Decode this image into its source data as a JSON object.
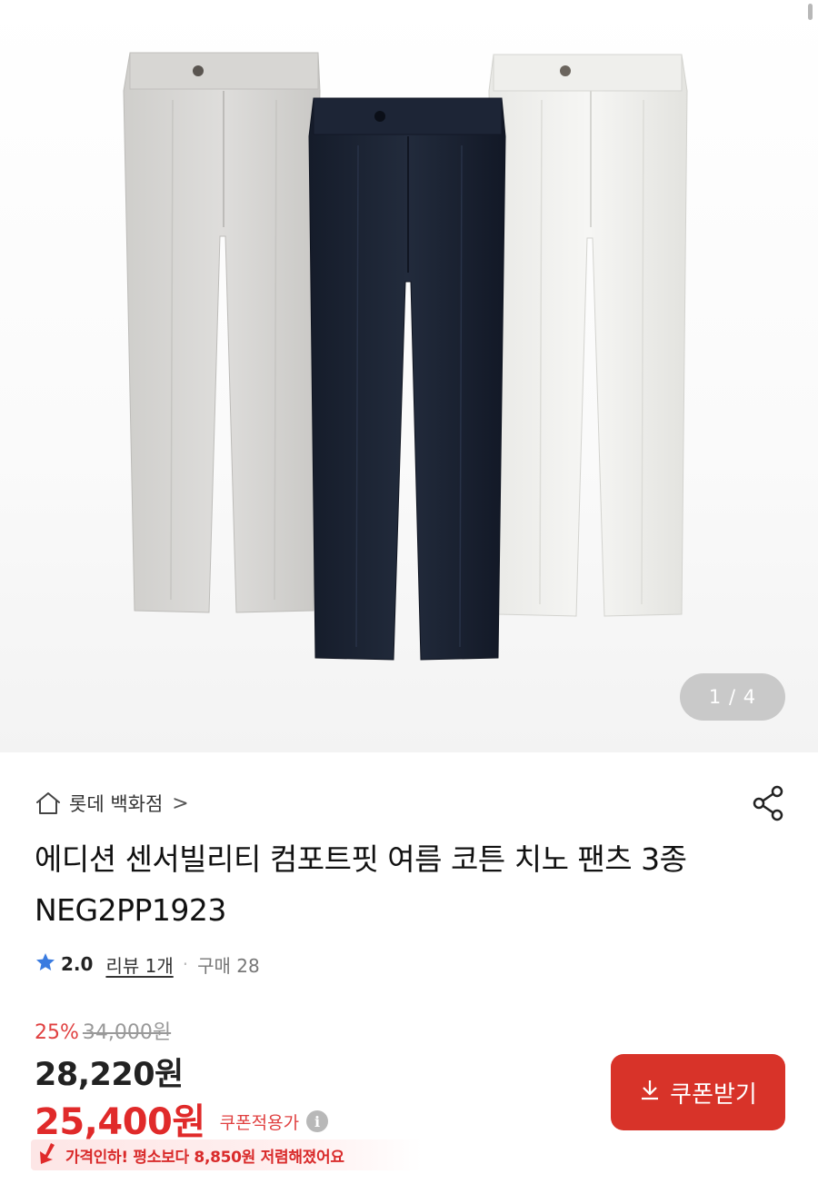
{
  "gallery": {
    "page_indicator": "1 / 4",
    "colors": {
      "pants_left": "#d6d5d3",
      "pants_middle": "#1b2333",
      "pants_right": "#efefec"
    }
  },
  "store": {
    "icon": "home-icon",
    "name": "롯데 백화점",
    "chevron": ">"
  },
  "share_icon": "share-icon",
  "product": {
    "title": "에디션 센서빌리티 컴포트핏 여름 코튼 치노 팬츠 3종 NEG2PP1923"
  },
  "rating": {
    "icon": "star-icon",
    "value": "2.0",
    "reviews": "리뷰 1개",
    "separator": "·",
    "purchases": "구매 28"
  },
  "pricing": {
    "discount": "25%",
    "original": "34,000원",
    "sale": "28,220원",
    "coupon_price": "25,400원",
    "coupon_label": "쿠폰적용가",
    "info_icon": "i",
    "price_drop": "가격인하! 평소보다 8,850원 저렴해졌어요"
  },
  "coupon_button": {
    "icon": "download-icon",
    "label": "쿠폰받기"
  },
  "accent_color": "#d83329"
}
